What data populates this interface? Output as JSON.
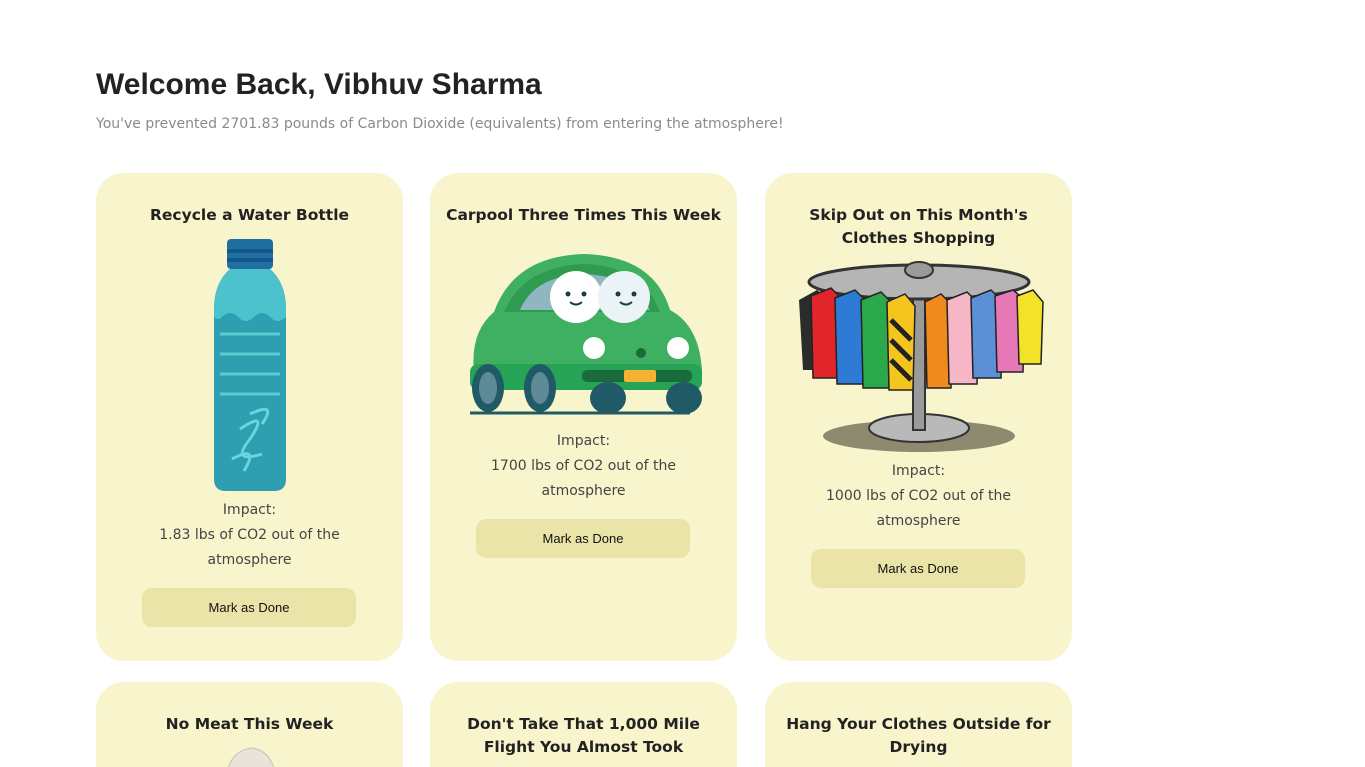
{
  "header": {
    "title": "Welcome Back, Vibhuv Sharma",
    "subtitle": "You've prevented 2701.83 pounds of Carbon Dioxide (equivalents) from entering the atmosphere!"
  },
  "colors": {
    "card_background": "#f8f5cd",
    "button_background": "#ebe4a8",
    "subtitle_text": "#8a8a8a"
  },
  "cards": [
    {
      "title": "Recycle a Water Bottle",
      "image": "water-bottle-image",
      "impact_label": "Impact:",
      "impact_text": "1.83 lbs of CO2 out of the atmosphere",
      "button_label": "Mark as Done"
    },
    {
      "title": "Carpool Three Times This Week",
      "image": "green-car-image",
      "impact_label": "Impact:",
      "impact_text": "1700 lbs of CO2 out of the atmosphere",
      "button_label": "Mark as Done"
    },
    {
      "title": "Skip Out on This Month's Clothes Shopping",
      "image": "clothes-rack-image",
      "impact_label": "Impact:",
      "impact_text": "1000 lbs of CO2 out of the atmosphere",
      "button_label": "Mark as Done"
    },
    {
      "title": "No Meat This Week",
      "image": "meat-image"
    },
    {
      "title": "Don't Take That 1,000 Mile Flight You Almost Took",
      "image": "airplane-image"
    },
    {
      "title": "Hang Your Clothes Outside for Drying",
      "image": "clothesline-image"
    }
  ]
}
